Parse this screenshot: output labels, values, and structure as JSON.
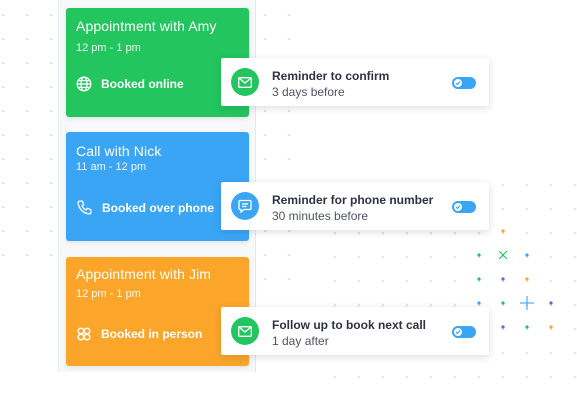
{
  "appointments": [
    {
      "title": "Appointment with Amy",
      "time": "12 pm - 1 pm",
      "booking": "Booked online",
      "icon": "globe-icon",
      "color": "#22c55e"
    },
    {
      "title": "Call with Nick",
      "time": "11 am - 12 pm",
      "booking": "Booked over phone",
      "icon": "phone-icon",
      "color": "#3aa5f5"
    },
    {
      "title": "Appointment with Jim",
      "time": "12 pm - 1 pm",
      "booking": "Booked in person",
      "icon": "people-icon",
      "color": "#fba62a"
    }
  ],
  "reminders": [
    {
      "title": "Reminder to confirm",
      "subtitle": "3 days before",
      "icon": "envelope-icon",
      "icon_color": "#22c55e",
      "toggle_on": true
    },
    {
      "title": "Reminder for phone number",
      "subtitle": "30 minutes before",
      "icon": "chat-bubble-icon",
      "icon_color": "#3aa5f5",
      "toggle_on": true
    },
    {
      "title": "Follow up to book next call",
      "subtitle": "1 day after",
      "icon": "envelope-icon",
      "icon_color": "#22c55e",
      "toggle_on": true
    }
  ],
  "toggle_color": "#3aa5f5"
}
